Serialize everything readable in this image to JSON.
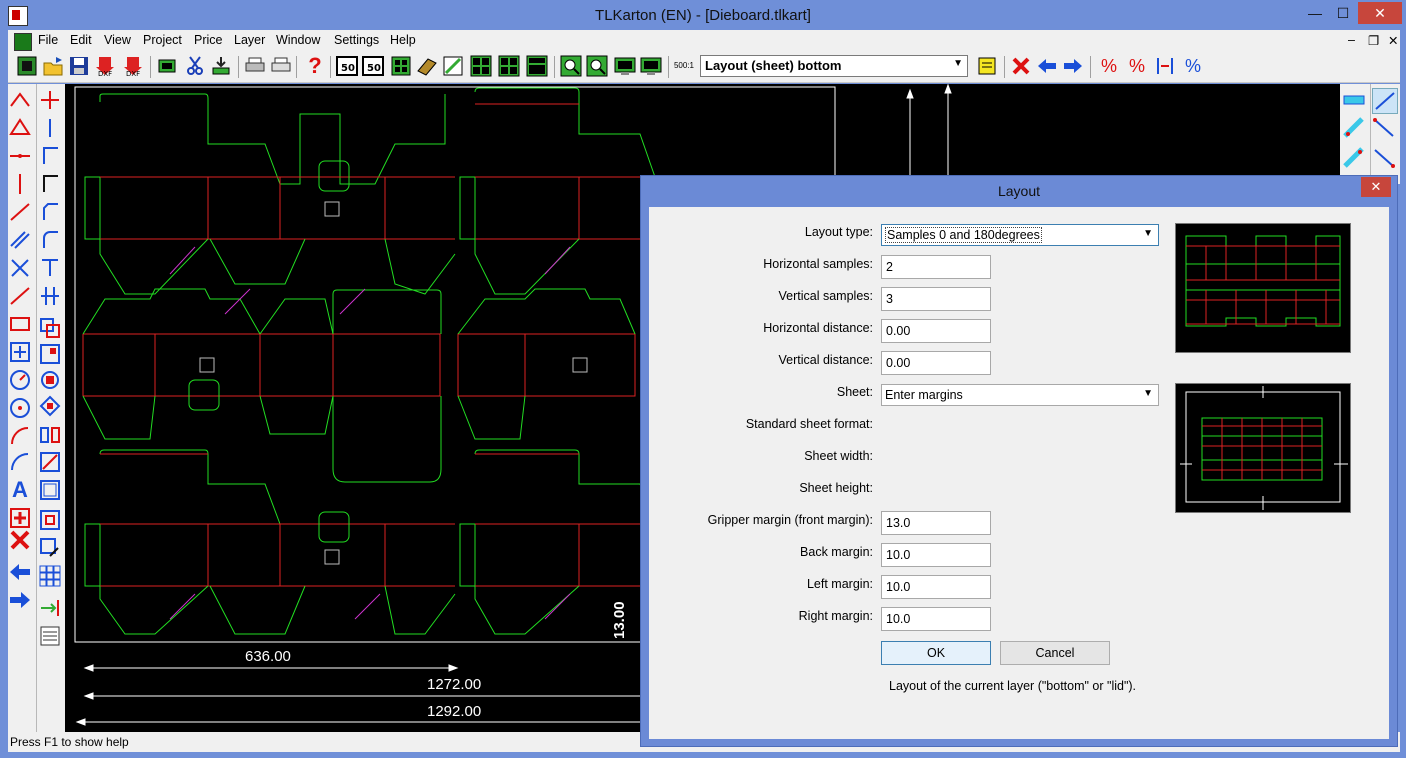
{
  "window": {
    "title": "TLKarton (EN) - [Dieboard.tlkart]",
    "minimize": "—",
    "maximize": "☐",
    "close": "✕"
  },
  "menu": [
    "File",
    "Edit",
    "View",
    "Project",
    "Price",
    "Layer",
    "Window",
    "Settings",
    "Help"
  ],
  "toolbar": {
    "layout_select": "Layout (sheet) bottom",
    "icons": [
      "app-icon",
      "open-icon",
      "save-icon",
      "export-dxf-icon",
      "import-dxf-icon",
      "sheet-icon",
      "cut-icon",
      "download-icon",
      "print-icon",
      "print-preview-icon",
      "help-icon",
      "counter-50-icon",
      "counter-50-alt-icon",
      "grid-icon",
      "layer-icon",
      "fold-icon",
      "layout-icon",
      "layout-alt-icon",
      "table-icon",
      "zoom-out-icon",
      "zoom-in-icon",
      "zoom-window-icon",
      "zoom-all-icon",
      "scale-500-icon",
      "notes-icon",
      "delete-icon",
      "back-icon",
      "forward-icon",
      "percent-icon",
      "percent-edit-icon",
      "align-icon",
      "percent-alt-icon"
    ],
    "scale_label": "500:1"
  },
  "canvas": {
    "dim1": "636.00",
    "dim2": "1272.00",
    "dim3": "1292.00",
    "dim_vertical": "13.00"
  },
  "status": "Press F1 to show help",
  "dialog": {
    "title": "Layout",
    "close": "✕",
    "labels": {
      "layout_type": "Layout type:",
      "h_samples": "Horizontal samples:",
      "v_samples": "Vertical samples:",
      "h_distance": "Horizontal distance:",
      "v_distance": "Vertical distance:",
      "sheet": "Sheet:",
      "std_format": "Standard sheet format:",
      "sheet_width": "Sheet width:",
      "sheet_height": "Sheet height:",
      "gripper": "Gripper margin (front margin):",
      "back": "Back margin:",
      "left": "Left margin:",
      "right": "Right margin:"
    },
    "values": {
      "layout_type": "Samples 0 and 180degrees",
      "h_samples": "2",
      "v_samples": "3",
      "h_distance": "0.00",
      "v_distance": "0.00",
      "sheet": "Enter margins",
      "gripper": "13.0",
      "back": "10.0",
      "left": "10.0",
      "right": "10.0"
    },
    "ok": "OK",
    "cancel": "Cancel",
    "hint": "Layout of the current layer (\"bottom\" or \"lid\")."
  },
  "colors": {
    "cut": "#22dd22",
    "crease": "#dd2222",
    "perforation": "#cc33cc",
    "dimension": "#ffffff"
  }
}
